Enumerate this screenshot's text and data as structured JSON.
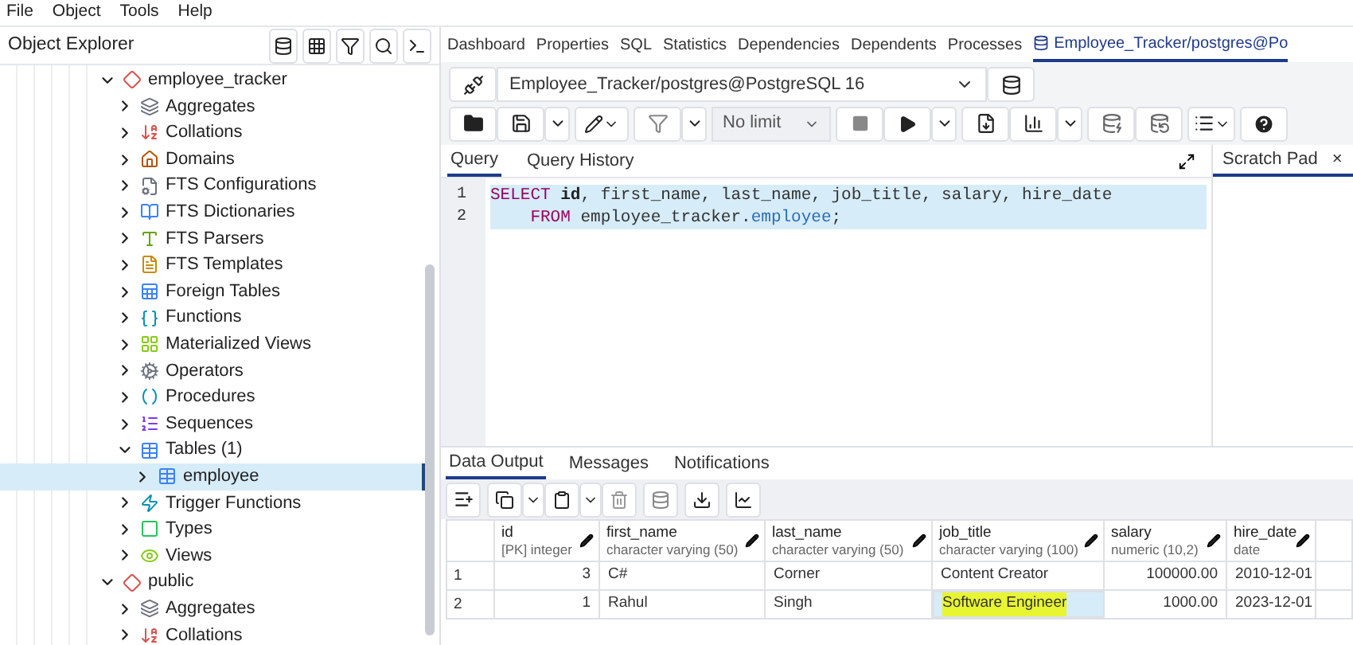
{
  "menu": [
    "File",
    "Object",
    "Tools",
    "Help"
  ],
  "explorer": {
    "title": "Object Explorer",
    "tree": [
      {
        "label": "employee_tracker",
        "kind": "schema",
        "expanded": true,
        "selected": false,
        "children": [
          {
            "label": "Aggregates",
            "kind": "aggregate",
            "expanded": false,
            "selected": false
          },
          {
            "label": "Collations",
            "kind": "collation",
            "expanded": false,
            "selected": false
          },
          {
            "label": "Domains",
            "kind": "domain",
            "expanded": false,
            "selected": false
          },
          {
            "label": "FTS Configurations",
            "kind": "fts-config",
            "expanded": false,
            "selected": false
          },
          {
            "label": "FTS Dictionaries",
            "kind": "fts-dict",
            "expanded": false,
            "selected": false
          },
          {
            "label": "FTS Parsers",
            "kind": "fts-parser",
            "expanded": false,
            "selected": false
          },
          {
            "label": "FTS Templates",
            "kind": "fts-template",
            "expanded": false,
            "selected": false
          },
          {
            "label": "Foreign Tables",
            "kind": "foreign-table",
            "expanded": false,
            "selected": false
          },
          {
            "label": "Functions",
            "kind": "function",
            "expanded": false,
            "selected": false
          },
          {
            "label": "Materialized Views",
            "kind": "matview",
            "expanded": false,
            "selected": false
          },
          {
            "label": "Operators",
            "kind": "operator",
            "expanded": false,
            "selected": false
          },
          {
            "label": "Procedures",
            "kind": "procedure",
            "expanded": false,
            "selected": false
          },
          {
            "label": "Sequences",
            "kind": "sequence",
            "expanded": false,
            "selected": false
          },
          {
            "label": "Tables (1)",
            "kind": "tables",
            "expanded": true,
            "selected": false,
            "children": [
              {
                "label": "employee",
                "kind": "table",
                "expanded": false,
                "selected": true
              }
            ]
          },
          {
            "label": "Trigger Functions",
            "kind": "trigger-function",
            "expanded": false,
            "selected": false
          },
          {
            "label": "Types",
            "kind": "type",
            "expanded": false,
            "selected": false
          },
          {
            "label": "Views",
            "kind": "view",
            "expanded": false,
            "selected": false
          }
        ]
      },
      {
        "label": "public",
        "kind": "schema",
        "expanded": true,
        "selected": false,
        "children": [
          {
            "label": "Aggregates",
            "kind": "aggregate",
            "expanded": false,
            "selected": false
          },
          {
            "label": "Collations",
            "kind": "collation",
            "expanded": false,
            "selected": false
          }
        ]
      }
    ]
  },
  "main_tabs": [
    {
      "label": "Dashboard",
      "selected": false
    },
    {
      "label": "Properties",
      "selected": false
    },
    {
      "label": "SQL",
      "selected": false
    },
    {
      "label": "Statistics",
      "selected": false
    },
    {
      "label": "Dependencies",
      "selected": false
    },
    {
      "label": "Dependents",
      "selected": false
    },
    {
      "label": "Processes",
      "selected": false
    },
    {
      "label": "Employee_Tracker/postgres@Po",
      "selected": true
    }
  ],
  "connection": "Employee_Tracker/postgres@PostgreSQL 16",
  "row_limit": "No limit",
  "editor_tabs": [
    {
      "label": "Query",
      "selected": true
    },
    {
      "label": "Query History",
      "selected": false
    }
  ],
  "scratch_pad": {
    "title": "Scratch Pad",
    "close": "×"
  },
  "editor_lines": [
    {
      "number": "1",
      "tokens": [
        {
          "kind": "keyword",
          "text": "SELECT "
        },
        {
          "kind": "bold",
          "text": "id"
        },
        {
          "kind": "plain",
          "text": ", first_name, last_name, job_title, salary, hire_date"
        }
      ]
    },
    {
      "number": "2",
      "tokens": [
        {
          "kind": "keyword",
          "text": "    FROM"
        },
        {
          "kind": "plain",
          "text": " employee_tracker."
        },
        {
          "kind": "name",
          "text": "employee"
        },
        {
          "kind": "plain",
          "text": ";"
        }
      ]
    }
  ],
  "output_tabs": [
    {
      "label": "Data Output",
      "selected": true
    },
    {
      "label": "Messages",
      "selected": false
    },
    {
      "label": "Notifications",
      "selected": false
    }
  ],
  "grid": {
    "columns": [
      {
        "name": "id",
        "type": "[PK] integer",
        "kind": "number"
      },
      {
        "name": "first_name",
        "type": "character varying (50)",
        "kind": "text"
      },
      {
        "name": "last_name",
        "type": "character varying (50)",
        "kind": "text"
      },
      {
        "name": "job_title",
        "type": "character varying (100)",
        "kind": "text"
      },
      {
        "name": "salary",
        "type": "numeric (10,2)",
        "kind": "number"
      },
      {
        "name": "hire_date",
        "type": "date",
        "kind": "text"
      }
    ],
    "rows": [
      {
        "number": "1",
        "cells": [
          {
            "text": "3",
            "selected": false
          },
          {
            "text": "C#",
            "selected": false
          },
          {
            "text": "Corner",
            "selected": false
          },
          {
            "text": "Content Creator",
            "selected": false
          },
          {
            "text": "100000.00",
            "selected": false
          },
          {
            "text": "2010-12-01",
            "selected": false
          }
        ]
      },
      {
        "number": "2",
        "cells": [
          {
            "text": "1",
            "selected": false
          },
          {
            "text": "Rahul",
            "selected": false
          },
          {
            "text": "Singh",
            "selected": false
          },
          {
            "text": "Software Engineer",
            "selected": true
          },
          {
            "text": "1000.00",
            "selected": false
          },
          {
            "text": "2023-12-01",
            "selected": false
          }
        ]
      }
    ]
  }
}
